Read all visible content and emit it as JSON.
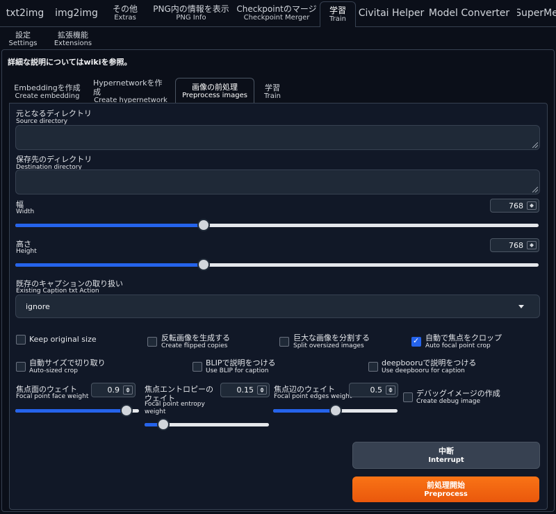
{
  "top_tabs": [
    {
      "l1": "txt2img",
      "l2": ""
    },
    {
      "l1": "img2img",
      "l2": ""
    },
    {
      "l1": "その他",
      "l2": "Extras"
    },
    {
      "l1": "PNG内の情報を表示",
      "l2": "PNG Info"
    },
    {
      "l1": "Checkpointのマージ",
      "l2": "Checkpoint Merger"
    },
    {
      "l1": "学習",
      "l2": "Train"
    },
    {
      "l1": "Civitai Helper",
      "l2": ""
    },
    {
      "l1": "Model Converter",
      "l2": ""
    },
    {
      "l1": "SuperMe",
      "l2": ""
    }
  ],
  "second_tabs": [
    {
      "l1": "設定",
      "l2": "Settings"
    },
    {
      "l1": "拡張機能",
      "l2": "Extensions"
    }
  ],
  "info_text": "詳細な説明についてはwikiを参照。",
  "train_tabs": [
    {
      "l1": "Embeddingを作成",
      "l2": "Create embedding"
    },
    {
      "l1": "Hypernetworkを作成",
      "l2": "Create hypernetwork"
    },
    {
      "l1": "画像の前処理",
      "l2": "Preprocess images"
    },
    {
      "l1": "学習",
      "l2": "Train"
    }
  ],
  "source_dir": {
    "l1": "元となるディレクトリ",
    "l2": "Source directory",
    "value": ""
  },
  "dest_dir": {
    "l1": "保存先のディレクトリ",
    "l2": "Destination directory",
    "value": ""
  },
  "width": {
    "l1": "幅",
    "l2": "Width",
    "value": "768",
    "fraction": 0.36
  },
  "height": {
    "l1": "高さ",
    "l2": "Height",
    "value": "768",
    "fraction": 0.36
  },
  "caption_action": {
    "l1": "既存のキャプションの取り扱い",
    "l2": "Existing Caption txt Action",
    "value": "ignore"
  },
  "checkboxes": {
    "keep_original": {
      "l1": "Keep original size",
      "l2": "",
      "checked": false
    },
    "flip": {
      "l1": "反転画像を生成する",
      "l2": "Create flipped copies",
      "checked": false
    },
    "split": {
      "l1": "巨大な画像を分割する",
      "l2": "Split oversized images",
      "checked": false
    },
    "focal_crop": {
      "l1": "自動で焦点をクロップ",
      "l2": "Auto focal point crop",
      "checked": true
    },
    "auto_size": {
      "l1": "自動サイズで切り取り",
      "l2": "Auto-sized crop",
      "checked": false
    },
    "blip": {
      "l1": "BLIPで説明をつける",
      "l2": "Use BLIP for caption",
      "checked": false
    },
    "deepbooru": {
      "l1": "deepbooruで説明をつける",
      "l2": "Use deepbooru for caption",
      "checked": false
    },
    "debug": {
      "l1": "デバッグイメージの作成",
      "l2": "Create debug image",
      "checked": false
    }
  },
  "focal_face": {
    "l1": "焦点面のウェイト",
    "l2": "Focal point face weight",
    "value": "0.9",
    "fraction": 0.9
  },
  "focal_entropy": {
    "l1": "焦点エントロピーのウェイト",
    "l2": "Focal point entropy weight",
    "value": "0.15",
    "fraction": 0.15
  },
  "focal_edges": {
    "l1": "焦点辺のウェイト",
    "l2": "Focal point edges weight",
    "value": "0.5",
    "fraction": 0.5
  },
  "interrupt_button": {
    "l1": "中断",
    "l2": "Interrupt"
  },
  "preprocess_button": {
    "l1": "前処理開始",
    "l2": "Preprocess"
  },
  "colors": {
    "accent": "#2563eb",
    "primary_button": "#ea580c",
    "secondary_button": "#374151",
    "background": "#0b0f19"
  }
}
